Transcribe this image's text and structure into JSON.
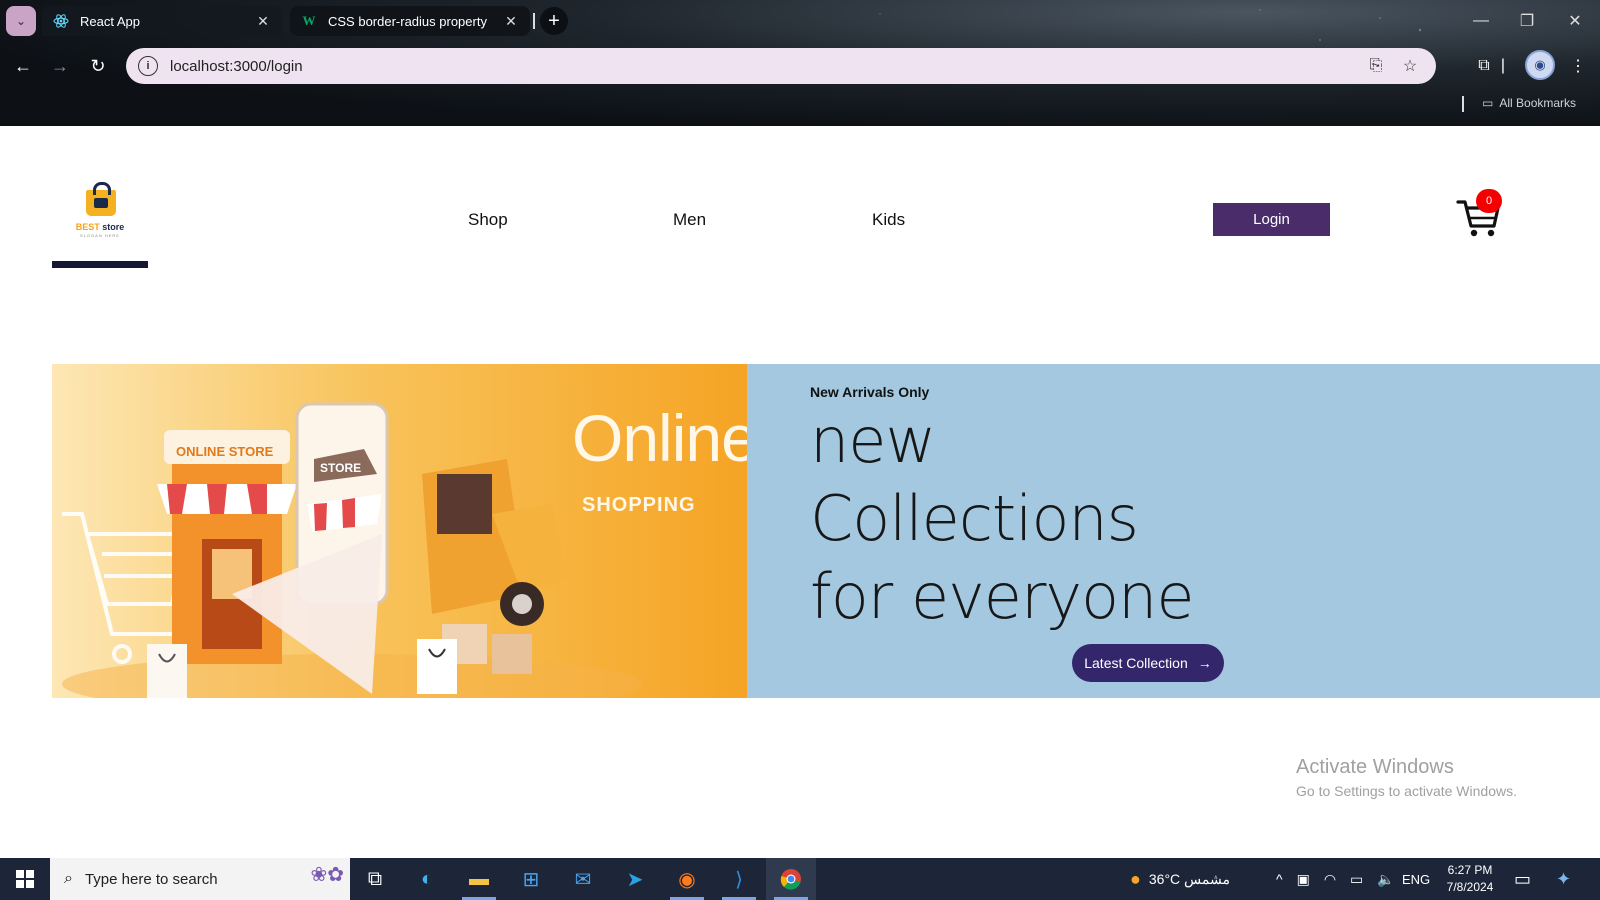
{
  "browser": {
    "tabs": [
      {
        "title": "React App",
        "active": true
      },
      {
        "title": "CSS border-radius property",
        "active": false
      }
    ],
    "address": "localhost:3000/login",
    "bookmarks_label": "All Bookmarks"
  },
  "site": {
    "logo": {
      "brand_a": "BEST",
      "brand_b": " store",
      "tagline": "SLOGAN HERE"
    },
    "nav": [
      {
        "label": "Shop"
      },
      {
        "label": "Men"
      },
      {
        "label": "Kids"
      }
    ],
    "login_label": "Login",
    "cart_count": "0"
  },
  "hero": {
    "banner_word": "Online.",
    "banner_sub": "SHOPPING",
    "banner_store_sign": "ONLINE STORE",
    "banner_phone_sign": "STORE",
    "eyebrow": "New Arrivals Only",
    "line1": "new",
    "line2": "Collections",
    "line3": "for everyone",
    "cta_label": "Latest Collection"
  },
  "watermark": {
    "line1": "Activate Windows",
    "line2": "Go to Settings to activate Windows."
  },
  "taskbar": {
    "search_placeholder": "Type here to search",
    "weather": "36°C  مشمس",
    "language": "ENG",
    "time": "6:27 PM",
    "date": "7/8/2024"
  },
  "colors": {
    "login_button": "#4a2c6b",
    "cta_button": "#34266b",
    "hero_bg": "#a3c8e0",
    "badge": "#f40000"
  }
}
